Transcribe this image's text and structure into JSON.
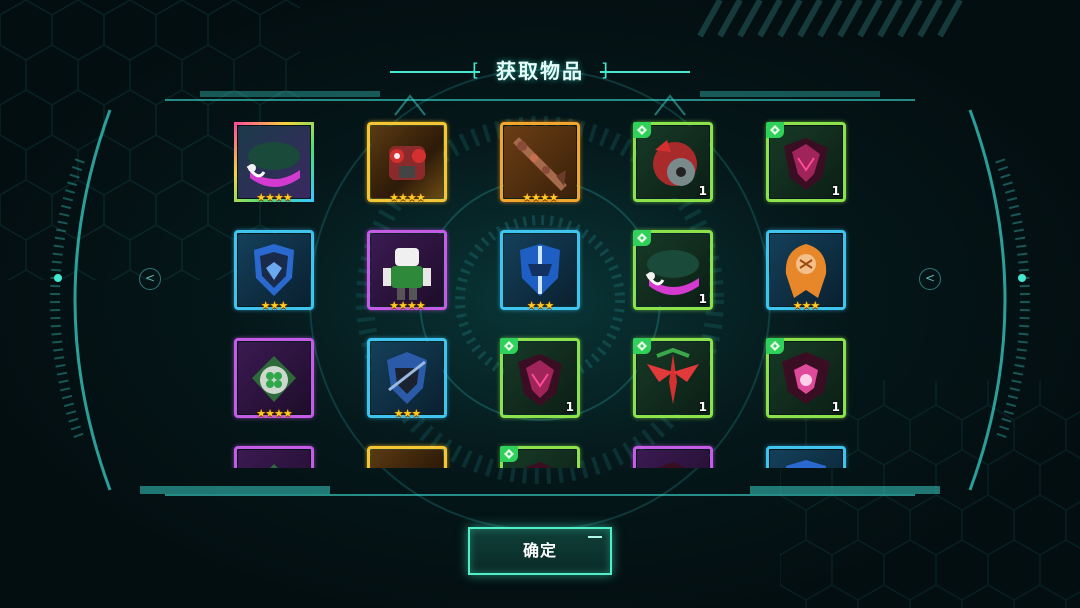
{
  "dialog": {
    "title": "获取物品",
    "confirm_label": "确定"
  },
  "colors": {
    "accent": "#46e8d0",
    "panel": "#0a2a2c",
    "star": "#ffcc22",
    "new_badge": "#2fd15a"
  },
  "items": [
    {
      "name": "rainbow-visor",
      "quality": "rainbow",
      "stars": "★★★★",
      "count": "",
      "new": false,
      "art": "visor"
    },
    {
      "name": "red-mech-torso",
      "quality": "gold",
      "stars": "★★★★",
      "count": "",
      "new": false,
      "art": "mech"
    },
    {
      "name": "chain-staff",
      "quality": "orange",
      "stars": "★★★★",
      "count": "",
      "new": false,
      "art": "staff"
    },
    {
      "name": "red-helmet-part",
      "quality": "green",
      "stars": "",
      "count": "1",
      "new": true,
      "art": "helmet"
    },
    {
      "name": "dark-armor-part",
      "quality": "green",
      "stars": "",
      "count": "1",
      "new": true,
      "art": "dark"
    },
    {
      "name": "blue-shield-emblem",
      "quality": "blue",
      "stars": "★★★",
      "count": "",
      "new": false,
      "art": "shield"
    },
    {
      "name": "green-mech",
      "quality": "purple",
      "stars": "★★★★",
      "count": "",
      "new": false,
      "art": "greenmech"
    },
    {
      "name": "blue-shield-sword",
      "quality": "blue",
      "stars": "★★★",
      "count": "",
      "new": false,
      "art": "shield2"
    },
    {
      "name": "visor-fragment",
      "quality": "green",
      "stars": "",
      "count": "1",
      "new": true,
      "art": "visor"
    },
    {
      "name": "orange-hood",
      "quality": "blue",
      "stars": "★★★",
      "count": "",
      "new": false,
      "art": "hood"
    },
    {
      "name": "clover-emblem",
      "quality": "purple",
      "stars": "★★★★",
      "count": "",
      "new": false,
      "art": "clover"
    },
    {
      "name": "dark-knight-shield",
      "quality": "blue",
      "stars": "★★★",
      "count": "",
      "new": false,
      "art": "shield3"
    },
    {
      "name": "dark-claw-part",
      "quality": "green",
      "stars": "",
      "count": "1",
      "new": true,
      "art": "dark"
    },
    {
      "name": "red-wing-emblem",
      "quality": "green",
      "stars": "",
      "count": "1",
      "new": true,
      "art": "wing"
    },
    {
      "name": "dark-crest-part",
      "quality": "green",
      "stars": "",
      "count": "1",
      "new": true,
      "art": "crest"
    },
    {
      "name": "partial-purple-item",
      "quality": "purple",
      "stars": "",
      "count": "",
      "new": false,
      "art": "clover"
    },
    {
      "name": "partial-gold-item",
      "quality": "gold",
      "stars": "",
      "count": "",
      "new": false,
      "art": "mech"
    },
    {
      "name": "partial-green-item",
      "quality": "green",
      "stars": "",
      "count": "",
      "new": true,
      "art": "dark"
    },
    {
      "name": "partial-purple-item-2",
      "quality": "purple",
      "stars": "",
      "count": "",
      "new": false,
      "art": "dark"
    },
    {
      "name": "partial-blue-item",
      "quality": "blue",
      "stars": "",
      "count": "",
      "new": false,
      "art": "shield"
    }
  ]
}
